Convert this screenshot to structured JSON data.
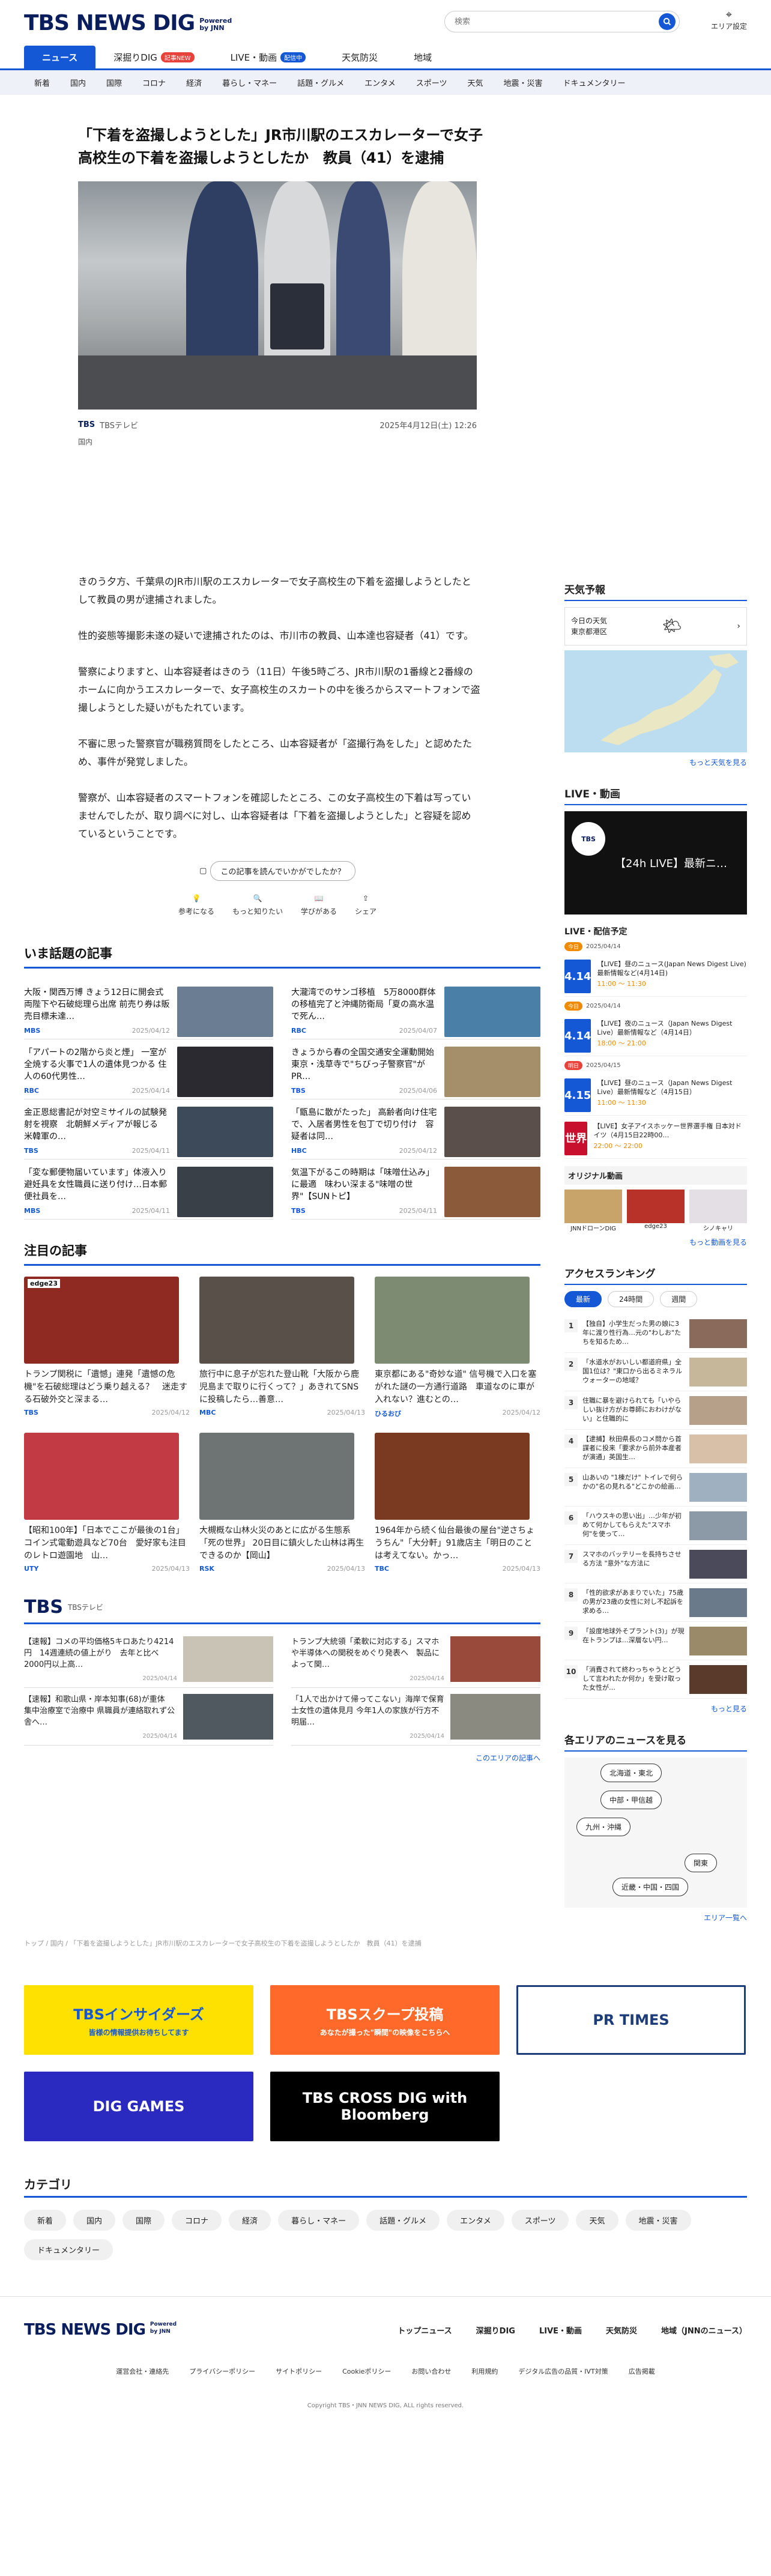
{
  "header": {
    "logo": "TBS NEWS DIG",
    "powered": "Powered by JNN",
    "search_placeholder": "検索",
    "area_setting": "エリア設定"
  },
  "mainnav": {
    "tabs": [
      {
        "label": "ニュース"
      },
      {
        "label": "深掘りDIG",
        "badge": "記事NEW"
      },
      {
        "label": "LIVE・動画",
        "badge": "配信中"
      },
      {
        "label": "天気防災"
      },
      {
        "label": "地域"
      }
    ]
  },
  "subnav": [
    "新着",
    "国内",
    "国際",
    "コロナ",
    "経済",
    "暮らし・マネー",
    "話題・グルメ",
    "エンタメ",
    "スポーツ",
    "天気",
    "地震・災害",
    "ドキュメンタリー"
  ],
  "article": {
    "headline": "「下着を盗撮しようとした」JR市川駅のエスカレーターで女子高校生の下着を盗撮しようとしたか　教員（41）を逮捕",
    "source": "TBSテレビ",
    "date": "2025年4月12日(土) 12:26",
    "category": "国内",
    "paragraphs": [
      "きのう夕方、千葉県のJR市川駅のエスカレーターで女子高校生の下着を盗撮しようとしたとして教員の男が逮捕されました。",
      "性的姿態等撮影未遂の疑いで逮捕されたのは、市川市の教員、山本達也容疑者（41）です。",
      "警察によりますと、山本容疑者はきのう（11日）午後5時ごろ、JR市川駅の1番線と2番線のホームに向かうエスカレーターで、女子高校生のスカートの中を後ろからスマートフォンで盗撮しようとした疑いがもたれています。",
      "不審に思った警察官が職務質問をしたところ、山本容疑者が「盗撮行為をした」と認めたため、事件が発覚しました。",
      "警察が、山本容疑者のスマートフォンを確認したところ、この女子高校生の下着は写っていませんでしたが、取り調べに対し、山本容疑者は「下着を盗撮しようとした」と容疑を認めているということです。"
    ],
    "feedback_q": "この記事を読んでいかがでしたか？",
    "reactions": [
      "参考になる",
      "もっと知りたい",
      "学びがある",
      "シェア"
    ]
  },
  "topics": {
    "title": "いま話題の記事",
    "items": [
      {
        "text": "大阪・関西万博 きょう12日に開会式 両陛下や石破総理ら出席 前売り券は販売目標未達…",
        "src": "MBS",
        "date": "2025/04/12",
        "c": "#6a7d93"
      },
      {
        "text": "大瀧湾でのサンゴ移植　5万8000群体の移植完了と沖縄防衛局「夏の高水温で死ん…",
        "src": "RBC",
        "date": "2025/04/07",
        "c": "#4a7fa8"
      },
      {
        "text": "「アパートの2階から炎と煙」 一室が全焼する火事で1人の遺体見つかる 住人の60代男性…",
        "src": "RBC",
        "date": "2025/04/14",
        "c": "#2a2a30"
      },
      {
        "text": "きょうから春の全国交通安全運動開始　東京・浅草寺で\"ちびっ子警察官\"がPR…",
        "src": "TBS",
        "date": "2025/04/06",
        "c": "#a58f6b"
      },
      {
        "text": "金正恩総書記が対空ミサイルの試験発射を視察　北朝鮮メディアが報じる　米韓軍の…",
        "src": "TBS",
        "date": "2025/04/11",
        "c": "#3d4a5a"
      },
      {
        "text": "「甑島に散がたった」 高齢者向け住宅で、入居者男性を包丁で切り付け　容疑者は同…",
        "src": "HBC",
        "date": "2025/04/12",
        "c": "#5a4f4a"
      },
      {
        "text": "「変な郵便物届いています」体液入り避妊具を女性職員に送り付け…日本郵便社員を…",
        "src": "MBS",
        "date": "2025/04/11",
        "c": "#3a4048"
      },
      {
        "text": "気温下がるこの時期は「味噌仕込み」に最適　味わい深まる\"味噌の世界\"【SUNトピ】",
        "src": "TBS",
        "date": "2025/04/11",
        "c": "#8a5a3a"
      }
    ]
  },
  "featured": {
    "title": "注目の記事",
    "items": [
      {
        "tag": "edge23",
        "text": "トランプ関税に「遺憾」連発「遺憾の危機\"を石破総理はどう乗り越える？　迷走する石破外交と深まる…",
        "src": "TBS",
        "date": "2025/04/12",
        "c": "#8f2a22"
      },
      {
        "text": "旅行中に息子が忘れた登山靴「大阪から鹿児島まで取りに行くって？」あきれてSNSに投稿したら…善意…",
        "src": "MBC",
        "date": "2025/04/13",
        "c": "#595049"
      },
      {
        "text": "東京都にある\"奇妙な道\" 信号機で入口を塞がれた謎の一方通行道路　車道なのに車が入れない？進むとの…",
        "src": "ひるおび",
        "date": "2025/04/12",
        "c": "#7e8b73"
      },
      {
        "text": "【昭和100年】「日本でここが最後の1台」コイン式電動遊具など70台　愛好家も注目のレトロ遊園地　山…",
        "src": "UTY",
        "date": "2025/04/13",
        "c": "#c23a44"
      },
      {
        "text": "大槻概な山林火災のあとに広がる生態系「死の世界」 20日目に鎮火した山林は再生できるのか【岡山】",
        "src": "RSK",
        "date": "2025/04/13",
        "c": "#6e7374"
      },
      {
        "text": "1964年から続く仙台最後の屋台\"逆さちょうちん\"「大分軒」91歳店主「明日のことは考えてない。かっ…",
        "src": "TBC",
        "date": "2025/04/13",
        "c": "#7a3a22"
      }
    ]
  },
  "tbs": {
    "logo": "TBS",
    "sub": "TBSテレビ",
    "items": [
      {
        "text": "【速報】コメの平均価格5キロあたり4214円　14週連続の値上がり　去年と比べ2000円以上高…",
        "date": "2025/04/14",
        "c": "#c9c3b6"
      },
      {
        "text": "トランプ大統領「柔軟に対応する」スマホや半導体への関税をめぐり発表へ　製品によって関…",
        "date": "2025/04/14",
        "c": "#9a4a3a"
      },
      {
        "text": "【速報】和歌山県・岸本知事(68)が重体　集中治療室で治療中 県職員が連絡取れず公舎へ…",
        "date": "2025/04/14",
        "c": "#505860"
      },
      {
        "text": "「1人で出かけて帰ってこない」海岸で保育士女性の遺体見月 今年1人の家族が行方不明届…",
        "date": "2025/04/14",
        "c": "#8a8a80"
      }
    ],
    "more": "このエリアの記事へ"
  },
  "breadcrumb": "トップ / 国内 / 「下着を盗撮しようとした」JR市川駅のエスカレーターで女子高校生の下着を盗撮しようとしたか　教員（41）を逮捕",
  "banners": [
    {
      "label": "TBSインサイダーズ",
      "sub": "皆様の情報提供お待ちしてます",
      "bg": "#ffe100",
      "fg": "#1558d6"
    },
    {
      "label": "TBSスクープ投稿",
      "sub": "あなたが撮った\"瞬間\"の映像をこちらへ",
      "bg": "#ff6a2a",
      "fg": "#ffffff"
    },
    {
      "label": "PR TIMES",
      "bg": "#ffffff",
      "fg": "#1d3d7a"
    },
    {
      "label": "DIG GAMES",
      "bg": "#2a2ac0",
      "fg": "#ffffff"
    },
    {
      "label": "TBS CROSS DIG with Bloomberg",
      "bg": "#000000",
      "fg": "#ffffff"
    }
  ],
  "categories": {
    "title": "カテゴリ",
    "items": [
      "新着",
      "国内",
      "国際",
      "コロナ",
      "経済",
      "暮らし・マネー",
      "話題・グルメ",
      "エンタメ",
      "スポーツ",
      "天気",
      "地震・災害",
      "ドキュメンタリー"
    ]
  },
  "footer": {
    "nav": [
      "トップニュース",
      "深掘りDIG",
      "LIVE・動画",
      "天気防災",
      "地域（JNNのニュース）"
    ],
    "links": [
      "運営会社・連絡先",
      "プライバシーポリシー",
      "サイトポリシー",
      "Cookieポリシー",
      "お問い合わせ",
      "利用規約",
      "デジタル広告の品質・IVT対策",
      "広告掲載"
    ],
    "copyright": "Copyright TBS・JNN NEWS DIG, ALL rights reserved."
  },
  "sidebar": {
    "weather": {
      "title": "天気予報",
      "today": "今日の天気",
      "place": "東京都港区",
      "more": "もっと天気を見る"
    },
    "live": {
      "title": "LIVE・動画",
      "now_title": "【24h LIVE】最新ニ…",
      "sched_title": "LIVE・配信予定",
      "items": [
        {
          "date": "4.14",
          "day": "今日",
          "when": "2025/04/14",
          "text": "【LIVE】昼のニュース(Japan News Digest Live) 最新情報など(4月14日)",
          "time": "11:00 〜 11:30"
        },
        {
          "date": "4.14",
          "day": "今日",
          "when": "2025/04/14",
          "text": "【LIVE】夜のニュース（Japan News Digest Live）最新情報など（4月14日）",
          "time": "18:00 〜 21:00"
        },
        {
          "date": "4.15",
          "day": "明日",
          "when": "2025/04/15",
          "text": "【LIVE】昼のニュース（Japan News Digest Live）最新情報など（4月15日）",
          "time": "11:00 〜 11:30"
        },
        {
          "date": "世界",
          "day": "",
          "when": "",
          "text": "【LIVE】女子アイスホッケー世界選手権 日本対ドイツ（4月15日22時00…",
          "time": "22:00 〜 22:00"
        }
      ],
      "original": "オリジナル動画",
      "originals": [
        "JNNドローンDIG",
        "edge23",
        "シノキャリ"
      ],
      "more": "もっと動画を見る"
    },
    "ranking": {
      "title": "アクセスランキング",
      "tabs": [
        "最新",
        "24時間",
        "週間"
      ],
      "items": [
        "【独自】小学生だった男の娘に3年に渡り性行為…元の\"わしお\"たちを知るため…",
        "「水道水がおいしい都道府県」全国1位は？\"東口から出るミネラルウォーターの地域？",
        "住職に暴を避けられても「いやらしい抜け方がお尊師におわけがない」と住職的に",
        "【逮捕】秋田県長のコメ問から首謀者に投来「要求から前外本産者が演通」英国生…",
        "山あいの \"1棟だけ\" トイレで何らかの\"名の見れる\"どこかの絵画…",
        "「ハウスキの思い出」…少年が初めて何かしてもらえた\"スマホ何\"を使って…",
        "スマホのバッテリーを長持ちさせる方法 \"意外\"な方法に",
        "「性的欲求があまりでいた」75歳の男が23歳の女性に対し不起訴を求める…",
        "「設度地球外そプラント(3)」が現在トランプは…深層ない円…",
        "「消費されて終わっちゃうとどうして言われたか何か」を受け取った女性が…"
      ],
      "more": "もっと見る"
    },
    "areas": {
      "title": "各エリアのニュースを見る",
      "buttons": [
        "北海道・東北",
        "中部・甲信越",
        "九州・沖縄",
        "関東",
        "近畿・中国・四国"
      ],
      "more": "エリア一覧へ"
    }
  }
}
